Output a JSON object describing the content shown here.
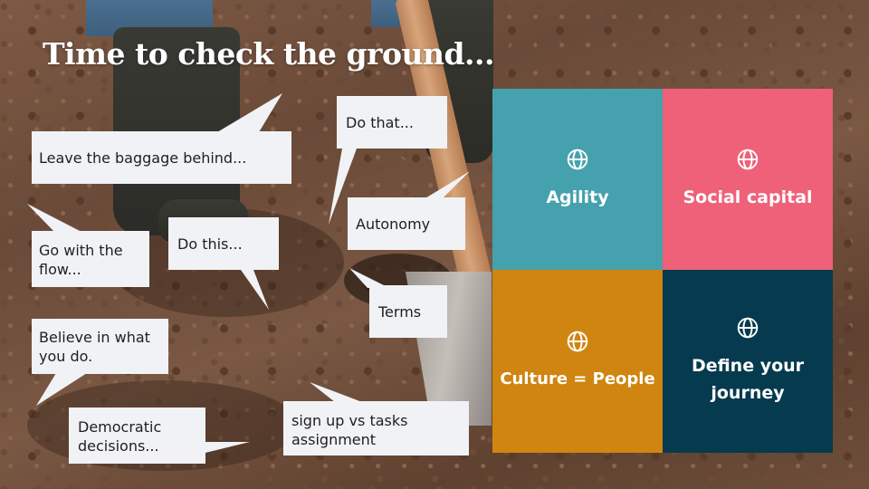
{
  "slide": {
    "title": "Time to check the ground..."
  },
  "bubbles": {
    "leave_baggage": "Leave the baggage behind...",
    "do_that": "Do that...",
    "autonomy": "Autonomy",
    "go_with_flow": "Go with the flow...",
    "do_this": "Do this...",
    "terms": "Terms",
    "believe": "Believe in what you do.",
    "democratic": "Democratic decisions...",
    "signup": "sign up vs tasks assignment"
  },
  "grid": {
    "cells": [
      {
        "label": "Agility",
        "color": "#45a1ad",
        "icon": "globe-icon"
      },
      {
        "label": "Social capital",
        "color": "#ef6079",
        "icon": "globe-icon"
      },
      {
        "label": "Culture = People",
        "color": "#cf850f",
        "icon": "globe-icon"
      },
      {
        "label": "Define your journey",
        "color": "#063a4e",
        "icon": "globe-icon"
      }
    ]
  }
}
